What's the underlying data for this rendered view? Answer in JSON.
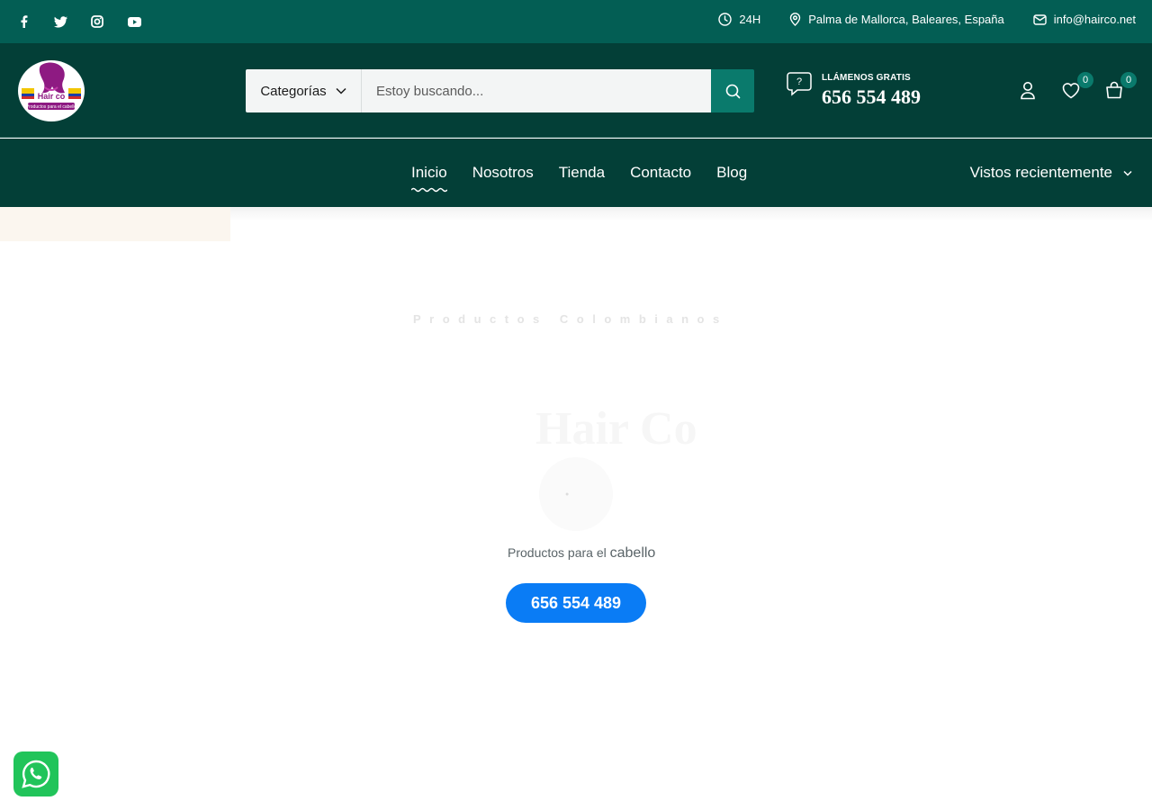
{
  "topbar": {
    "social": [
      "facebook-icon",
      "twitter-icon",
      "instagram-icon",
      "youtube-icon"
    ],
    "hours": "24H",
    "location": "Palma de Mallorca, Baleares, España",
    "email": "info@hairco.net"
  },
  "header": {
    "logo": {
      "brand": "Hair co",
      "tagline": "Productos para el cabello"
    },
    "search": {
      "category_label": "Categorías",
      "placeholder": "Estoy buscando..."
    },
    "call": {
      "label": "LLÁMENOS GRATIS",
      "number": "656 554 489"
    },
    "wishlist_count": "0",
    "cart_count": "0"
  },
  "nav": {
    "items": [
      "Inicio",
      "Nosotros",
      "Tienda",
      "Contacto",
      "Blog"
    ],
    "active": "Inicio",
    "recent_label": "Vistos recientemente"
  },
  "hero": {
    "subtitle": "Productos Colombianos",
    "title": "Hair Co",
    "tagline_part1": "Productos para el",
    "tagline_part2": "cabello",
    "cta_label": "656 554 489"
  },
  "colors": {
    "topbar": "#035e54",
    "header": "#033f37",
    "accent": "#0a7a6c",
    "cta": "#0a7cf5",
    "whatsapp": "#21c45a"
  }
}
